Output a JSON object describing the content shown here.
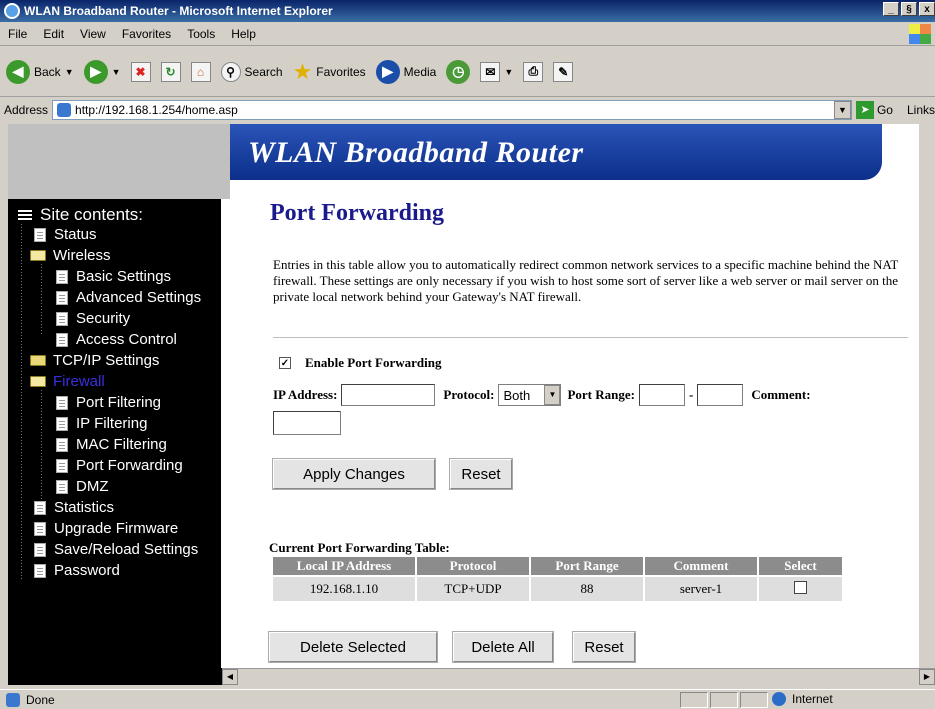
{
  "window": {
    "title": "WLAN Broadband Router - Microsoft Internet Explorer",
    "min": "_",
    "max": "§",
    "close": "x"
  },
  "menu": [
    "File",
    "Edit",
    "View",
    "Favorites",
    "Tools",
    "Help"
  ],
  "toolbar": {
    "back": "Back",
    "search": "Search",
    "favorites": "Favorites",
    "media": "Media"
  },
  "address": {
    "label": "Address",
    "url": "http://192.168.1.254/home.asp",
    "go": "Go",
    "links": "Links"
  },
  "banner": {
    "title": "WLAN Broadband Router"
  },
  "sidebar": {
    "heading": "Site contents:",
    "items": [
      {
        "label": "Status"
      },
      {
        "label": "Wireless"
      },
      {
        "label": "Basic Settings"
      },
      {
        "label": "Advanced Settings"
      },
      {
        "label": "Security"
      },
      {
        "label": "Access Control"
      },
      {
        "label": "TCP/IP Settings"
      },
      {
        "label": "Firewall"
      },
      {
        "label": "Port Filtering"
      },
      {
        "label": "IP Filtering"
      },
      {
        "label": "MAC Filtering"
      },
      {
        "label": "Port Forwarding"
      },
      {
        "label": "DMZ"
      },
      {
        "label": "Statistics"
      },
      {
        "label": "Upgrade Firmware"
      },
      {
        "label": "Save/Reload Settings"
      },
      {
        "label": "Password"
      }
    ]
  },
  "page": {
    "title": "Port Forwarding",
    "description": "Entries in this table allow you to automatically redirect common network services to a specific machine behind the NAT firewall. These settings are only necessary if you wish to host some sort of server like a web server or mail server on the private local network behind your Gateway's NAT firewall.",
    "enable_label": "Enable Port Forwarding",
    "enable_checked": true,
    "ip_label": "IP Address:",
    "protocol_label": "Protocol:",
    "protocol_value": "Both",
    "port_range_label": "Port Range:",
    "port_sep": "-",
    "comment_label": "Comment:",
    "apply": "Apply Changes",
    "reset": "Reset"
  },
  "table": {
    "title": "Current Port Forwarding Table:",
    "headers": [
      "Local IP Address",
      "Protocol",
      "Port Range",
      "Comment",
      "Select"
    ],
    "rows": [
      {
        "ip": "192.168.1.10",
        "protocol": "TCP+UDP",
        "port": "88",
        "comment": "server-1",
        "selected": false
      }
    ],
    "delete_selected": "Delete Selected",
    "delete_all": "Delete All",
    "reset": "Reset"
  },
  "status": {
    "text": "Done",
    "zone": "Internet"
  }
}
